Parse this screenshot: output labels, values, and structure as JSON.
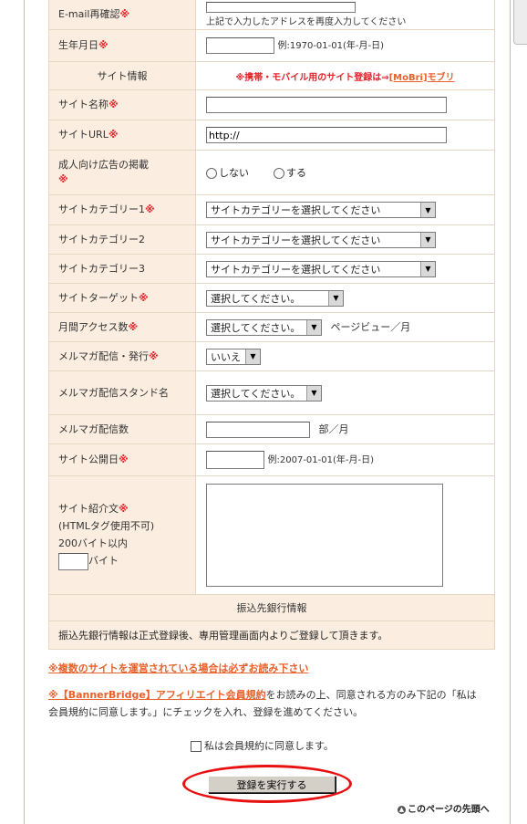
{
  "form": {
    "email_confirm": {
      "label": "E-mail再確認",
      "req": "※",
      "hint": "上記で入力したアドレスを再度入力してください"
    },
    "birthdate": {
      "label": "生年月日",
      "req": "※",
      "example": "例:1970-01-01(年-月-日)"
    },
    "site_info_header": {
      "label": "サイト情報",
      "mobile_note": "※携帯・モバイル用のサイト登録は⇒",
      "mobile_link": "[MoBri]モブリ"
    },
    "site_name": {
      "label": "サイト名称",
      "req": "※"
    },
    "site_url": {
      "label": "サイトURL",
      "req": "※",
      "value": "http://"
    },
    "adult_ads": {
      "label": "成人向け広告の掲載",
      "req": "※",
      "option_no": "しない",
      "option_yes": "する"
    },
    "category1": {
      "label": "サイトカテゴリー1",
      "req": "※",
      "selected": "サイトカテゴリーを選択してください"
    },
    "category2": {
      "label": "サイトカテゴリー2",
      "selected": "サイトカテゴリーを選択してください"
    },
    "category3": {
      "label": "サイトカテゴリー3",
      "selected": "サイトカテゴリーを選択してください"
    },
    "target": {
      "label": "サイトターゲット",
      "req": "※",
      "selected": "選択してください。"
    },
    "monthly_access": {
      "label": "月間アクセス数",
      "req": "※",
      "selected": "選択してください。",
      "unit": "ページビュー／月"
    },
    "newsletter": {
      "label": "メルマガ配信・発行",
      "req": "※",
      "selected": "いいえ"
    },
    "newsletter_stand": {
      "label": "メルマガ配信スタンド名",
      "selected": "選択してください。"
    },
    "newsletter_count": {
      "label": "メルマガ配信数",
      "unit": "部／月"
    },
    "publish_date": {
      "label": "サイト公開日",
      "req": "※",
      "example": "例:2007-01-01(年-月-日)"
    },
    "intro": {
      "label": "サイト紹介文",
      "req": "※",
      "line2": "(HTMLタグ使用不可)",
      "line3": "200バイト以内",
      "byte_unit": "バイト"
    },
    "bank_header": {
      "label": "振込先銀行情報"
    },
    "bank_note": {
      "text": "振込先銀行情報は正式登録後、専用管理画面内よりご登録して頂きます。"
    }
  },
  "multi_site_note": "※複数のサイトを運営されている場合は必ずお読み下さい",
  "agreement": {
    "link": "※【BannerBridge】アフィリエイト会員規約",
    "text1": "をお読みの上、同意される方のみ下記の「私は会員規約に同意します。」にチェックを入れ、登録を進めてください。",
    "checkbox_label": "私は会員規約に同意します。"
  },
  "submit_label": "登録を実行する",
  "page_top_label": "このページの先頭へ",
  "colors": {
    "label_bg": "#fbeee0",
    "required": "#e8202a",
    "link": "#e8602a",
    "highlight_oval": "#e81010"
  }
}
